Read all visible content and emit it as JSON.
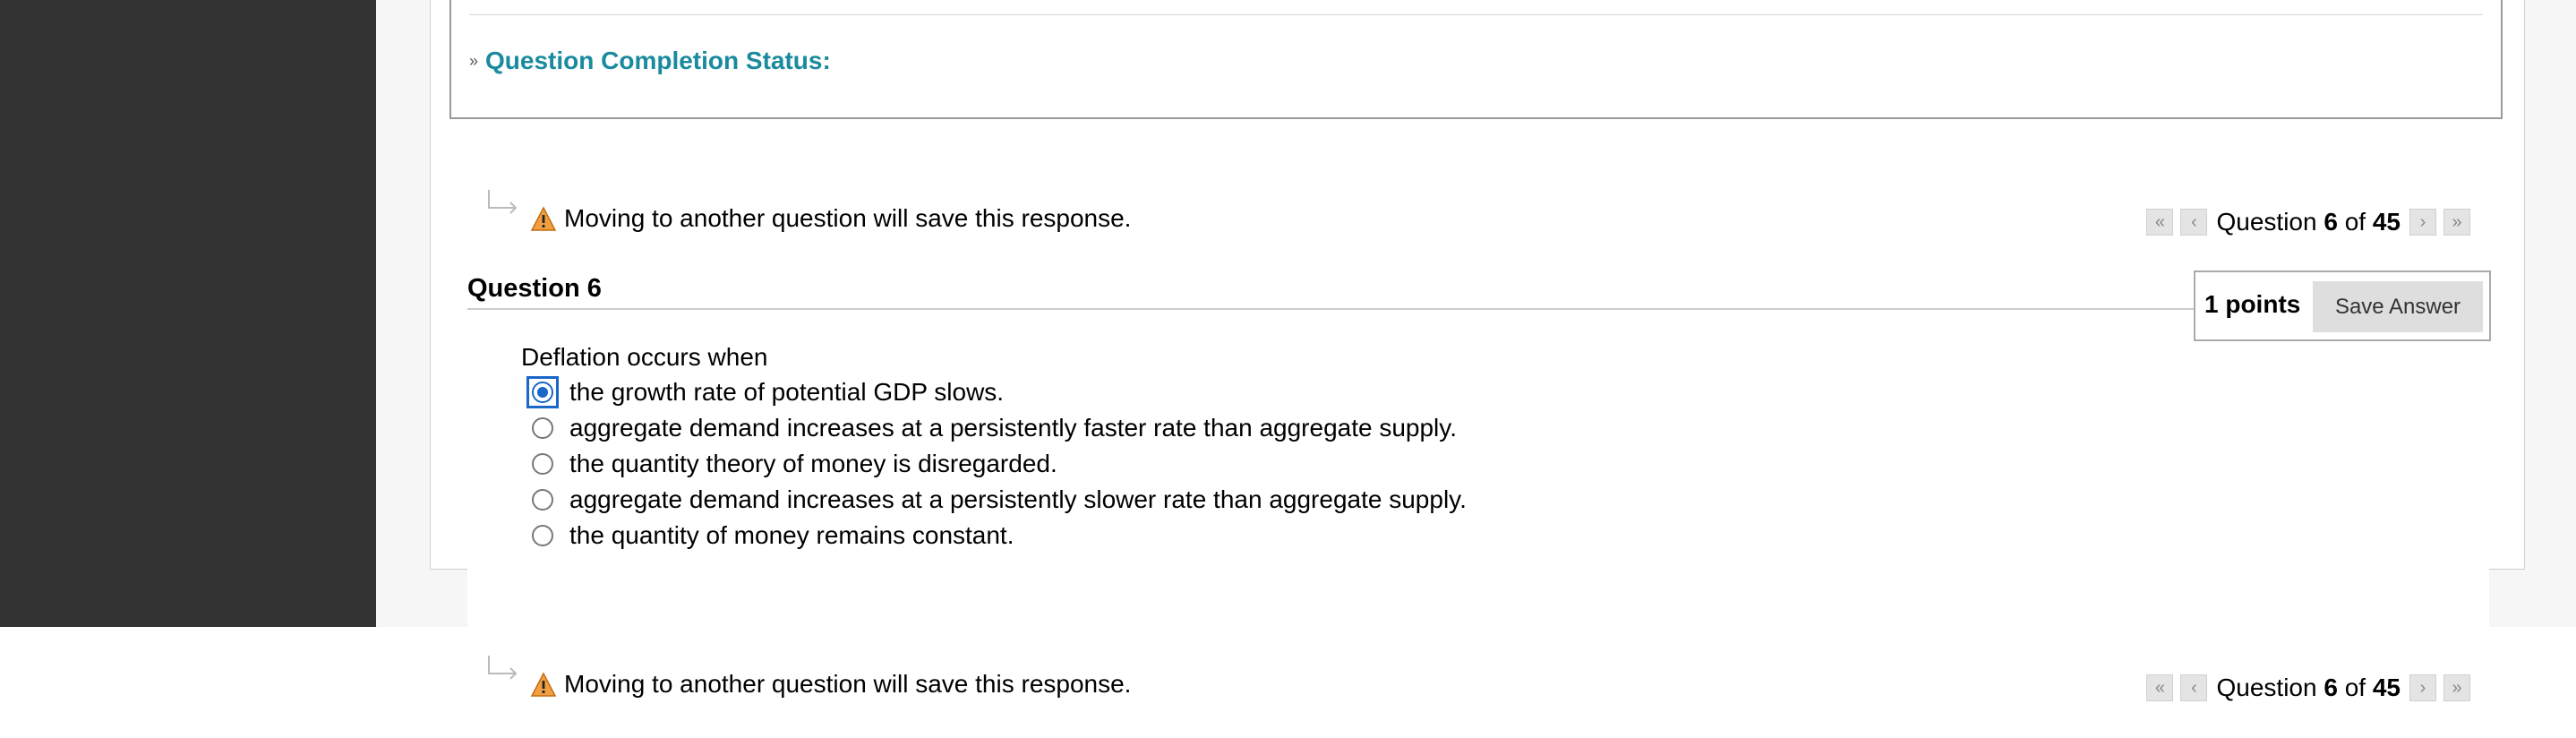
{
  "status": {
    "label": "Question Completion Status:"
  },
  "hint": {
    "message": "Moving to another question will save this response."
  },
  "pager": {
    "prefix": "Question",
    "current": "6",
    "of": "of",
    "total": "45"
  },
  "question": {
    "title": "Question 6",
    "points": "1 points",
    "save_label": "Save Answer",
    "text": "Deflation occurs when",
    "answers": [
      {
        "label": "the growth rate of potential GDP slows.",
        "selected": true
      },
      {
        "label": "aggregate demand increases at a persistently faster rate than aggregate supply.",
        "selected": false
      },
      {
        "label": "the quantity theory of money is disregarded.",
        "selected": false
      },
      {
        "label": "aggregate demand increases at a persistently slower rate than aggregate supply.",
        "selected": false
      },
      {
        "label": "the quantity of money remains constant.",
        "selected": false
      }
    ]
  },
  "colors": {
    "accent": "#1a8a9e",
    "radio_selected": "#1a66c9",
    "sidebar": "#333333"
  }
}
